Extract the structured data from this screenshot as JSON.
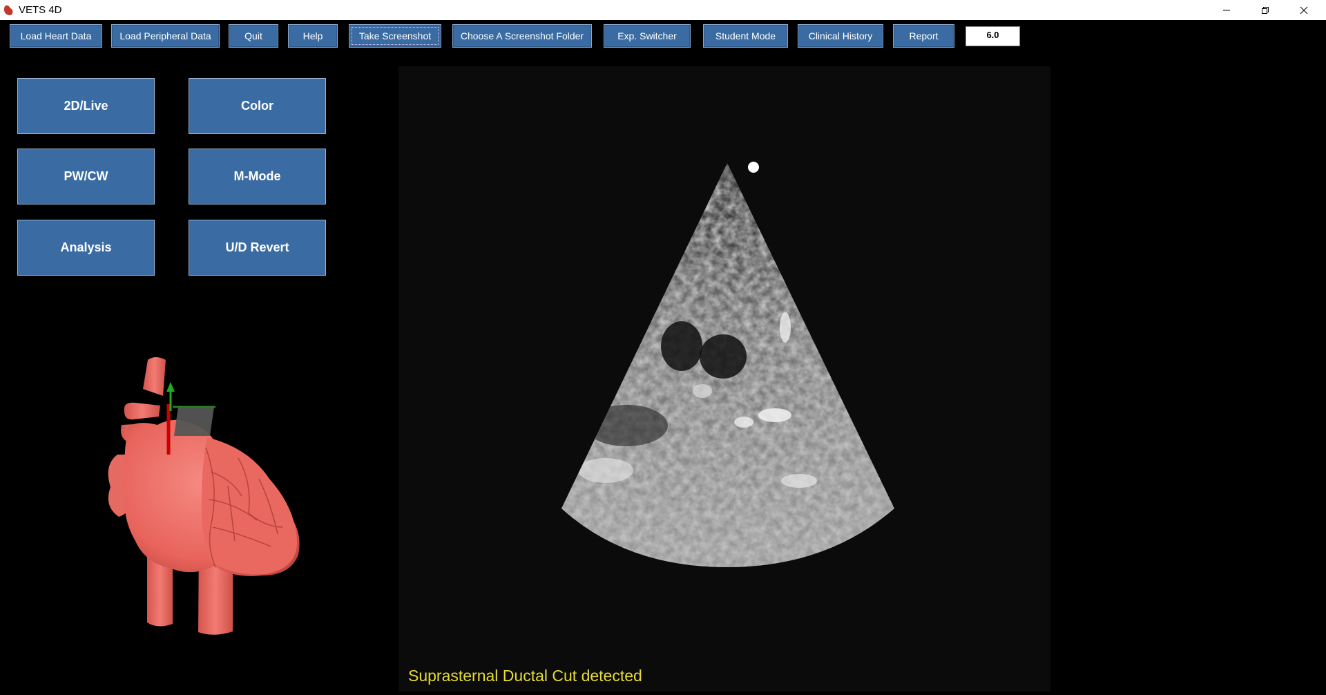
{
  "window": {
    "title": "VETS 4D"
  },
  "toolbar": {
    "buttons": [
      {
        "label": "Load Heart Data"
      },
      {
        "label": "Load Peripheral Data"
      },
      {
        "label": "Quit"
      },
      {
        "label": "Help"
      },
      {
        "label": "Take Screenshot"
      },
      {
        "label": "Choose A Screenshot Folder"
      },
      {
        "label": "Exp. Switcher"
      },
      {
        "label": "Student Mode"
      },
      {
        "label": "Clinical History"
      },
      {
        "label": "Report"
      }
    ],
    "zoom_value": "6.0"
  },
  "modes": {
    "live": "2D/Live",
    "color": "Color",
    "pwcw": "PW/CW",
    "mmode": "M-Mode",
    "analysis": "Analysis",
    "revert": "U/D Revert"
  },
  "status": {
    "message": "Suprasternal Ductal Cut detected"
  },
  "colors": {
    "button_bg": "#3a6ca3",
    "heart": "#ef7069",
    "status_text": "#e6dc33"
  },
  "icons": {
    "app": "heart-app-icon",
    "minimize": "minimize-icon",
    "maximize": "restore-icon",
    "close": "close-icon"
  }
}
